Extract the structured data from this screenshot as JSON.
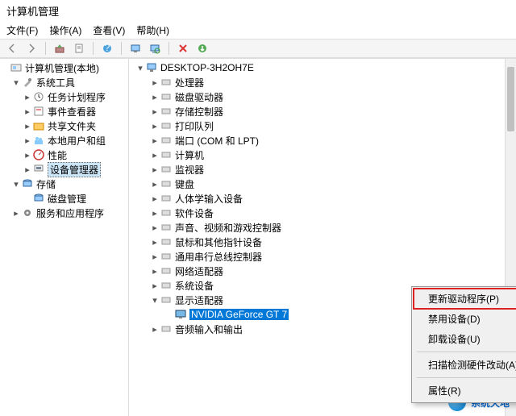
{
  "window_title": "计算机管理",
  "menu": {
    "file": "文件(F)",
    "action": "操作(A)",
    "view": "查看(V)",
    "help": "帮助(H)"
  },
  "toolbar_icons": {
    "back": "back-arrow",
    "forward": "forward-arrow",
    "up": "up-folder",
    "pipe": "pipe",
    "props": "properties",
    "refresh": "refresh",
    "monitor": "monitor",
    "scan": "scan",
    "stop": "delete",
    "go": "go"
  },
  "left_tree": {
    "root": "计算机管理(本地)",
    "system_tools": "系统工具",
    "system_children": [
      "任务计划程序",
      "事件查看器",
      "共享文件夹",
      "本地用户和组",
      "性能",
      "设备管理器"
    ],
    "selected_index": 5,
    "storage": "存储",
    "storage_children": [
      "磁盘管理"
    ],
    "services": "服务和应用程序"
  },
  "device_tree": {
    "root": "DESKTOP-3H2OH7E",
    "categories": [
      {
        "label": "处理器",
        "expanded": false
      },
      {
        "label": "磁盘驱动器",
        "expanded": false
      },
      {
        "label": "存储控制器",
        "expanded": false
      },
      {
        "label": "打印队列",
        "expanded": false
      },
      {
        "label": "端口 (COM 和 LPT)",
        "expanded": false
      },
      {
        "label": "计算机",
        "expanded": false
      },
      {
        "label": "监视器",
        "expanded": false
      },
      {
        "label": "键盘",
        "expanded": false
      },
      {
        "label": "人体学输入设备",
        "expanded": false
      },
      {
        "label": "软件设备",
        "expanded": false
      },
      {
        "label": "声音、视频和游戏控制器",
        "expanded": false
      },
      {
        "label": "鼠标和其他指针设备",
        "expanded": false
      },
      {
        "label": "通用串行总线控制器",
        "expanded": false
      },
      {
        "label": "网络适配器",
        "expanded": false
      },
      {
        "label": "系统设备",
        "expanded": false
      },
      {
        "label": "显示适配器",
        "expanded": true,
        "children": [
          "NVIDIA GeForce GT 7"
        ]
      },
      {
        "label": "音频输入和输出",
        "expanded": false
      }
    ],
    "selected_device": "NVIDIA GeForce GT 7"
  },
  "context_menu": {
    "items": [
      "更新驱动程序(P)",
      "禁用设备(D)",
      "卸载设备(U)",
      "扫描检测硬件改动(A)",
      "属性(R)"
    ],
    "highlighted_index": 0
  },
  "watermark": "系统天地"
}
